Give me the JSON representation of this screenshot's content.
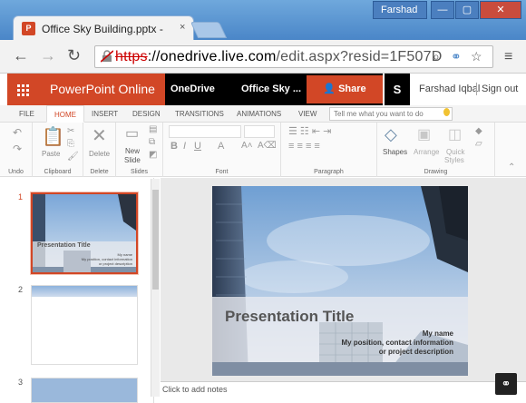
{
  "browser": {
    "tab_title": "Office Sky Building.pptx - ",
    "tab_close": "×",
    "user": "Farshad",
    "win_min": "—",
    "win_max": "▢",
    "win_close": "✕",
    "url_https": "https",
    "url_host": "://onedrive.live.com",
    "url_path": "/edit.aspx?resid=1F507D",
    "back": "←",
    "forward": "→",
    "reload": "↻"
  },
  "app": {
    "brand": "PowerPoint Online",
    "breadcrumb_onedrive": "OneDrive",
    "breadcrumb_file": "Office Sky ...",
    "share_label": "Share",
    "skype": "S",
    "user_name": "Farshad Iqbal",
    "sign_out": "Sign out"
  },
  "ribbon_tabs": [
    "FILE",
    "HOME",
    "INSERT",
    "DESIGN",
    "TRANSITIONS",
    "ANIMATIONS",
    "VIEW"
  ],
  "tell_me": "Tell me what you want to do",
  "ribbon": {
    "undo": "Undo",
    "clipboard": "Clipboard",
    "paste": "Paste",
    "delete_label": "Delete",
    "delete_group": "Delete",
    "new_slide": "New",
    "new_slide2": "Slide",
    "slides": "Slides",
    "font": "Font",
    "paragraph": "Paragraph",
    "shapes": "Shapes",
    "arrange": "Arrange",
    "quick": "Quick",
    "styles": "Styles",
    "drawing": "Drawing"
  },
  "slides_pane": {
    "numbers": [
      "1",
      "2",
      "3"
    ],
    "thumb_title": "Presentation Title",
    "thumb_sub1": "My name",
    "thumb_sub2": "My position, contact information",
    "thumb_sub3": "or project description"
  },
  "slide": {
    "title": "Presentation Title",
    "line1": "My name",
    "line2": "My position, contact information",
    "line3": "or project description"
  },
  "notes": "Click to add notes",
  "colors": {
    "accent": "#d24726",
    "black": "#000000"
  }
}
